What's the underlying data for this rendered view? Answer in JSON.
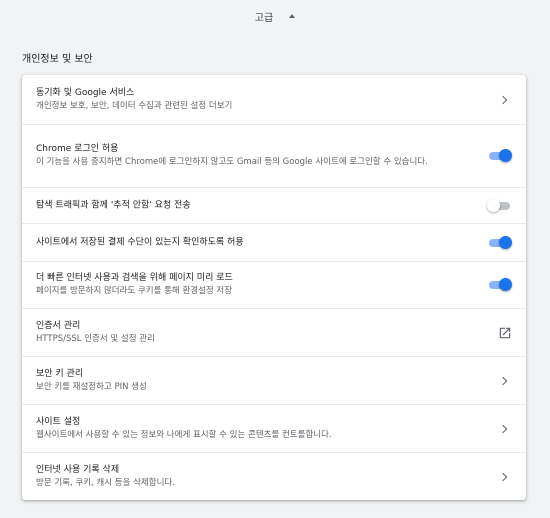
{
  "advanced": {
    "label": "고급",
    "icon": "caret-up-icon"
  },
  "section": {
    "title": "개인정보 및 보안"
  },
  "rows": [
    {
      "primary": "동기화 및 Google 서비스",
      "secondary": "개인정보 보호, 보안, 데이터 수집과 관련된 설정 더보기",
      "control": "chevron-right-icon"
    },
    {
      "primary": "Chrome 로그인 허용",
      "secondary": "이 기능을 사용 중지하면 Chrome에 로그인하지 않고도 Gmail 등의 Google 사이트에 로그인할 수 있습니다.",
      "control": "toggle",
      "enabled": true
    },
    {
      "primary": "탐색 트래픽과 함께 '추적 안함' 요청 전송",
      "control": "toggle",
      "enabled": false
    },
    {
      "primary": "사이트에서 저장된 결제 수단이 있는지 확인하도록 허용",
      "control": "toggle",
      "enabled": true
    },
    {
      "primary": "더 빠른 인터넷 사용과 검색을 위해 페이지 미리 로드",
      "secondary": "페이지를 방문하지 않더라도 쿠키를 통해 환경설정 저장",
      "control": "toggle",
      "enabled": true
    },
    {
      "primary": "인증서 관리",
      "secondary": "HTTPS/SSL 인증서 및 설정 관리",
      "control": "open-in-new-icon"
    },
    {
      "primary": "보안 키 관리",
      "secondary": "보안 키를 재설정하고 PIN 생성",
      "control": "chevron-right-icon"
    },
    {
      "primary": "사이트 설정",
      "secondary": "웹사이트에서 사용할 수 있는 정보와 나에게 표시할 수 있는 콘텐츠를 컨트롤합니다.",
      "control": "chevron-right-icon"
    },
    {
      "primary": "인터넷 사용 기록 삭제",
      "secondary": "방문 기록, 쿠키, 캐시 등을 삭제합니다.",
      "control": "chevron-right-icon"
    }
  ],
  "colors": {
    "accent": "#1a73e8",
    "accent_light": "#8ab4f8",
    "background": "#f1f3f4"
  }
}
